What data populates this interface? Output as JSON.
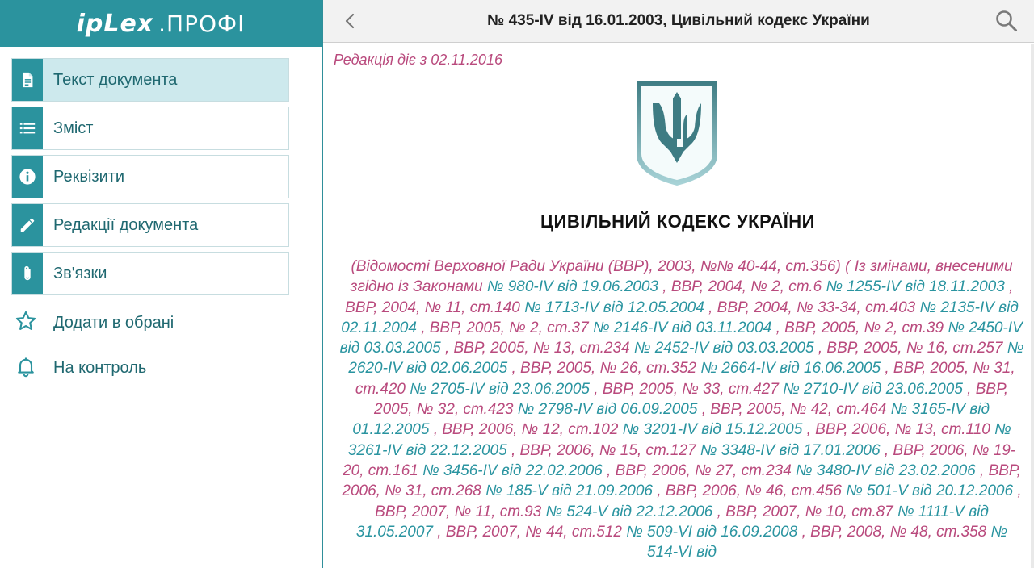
{
  "app": {
    "logo_brand": "ipLex",
    "logo_suffix": ".ПРОФІ"
  },
  "sidebar": {
    "items": [
      {
        "label": "Текст документа",
        "icon": "document-icon",
        "active": true
      },
      {
        "label": "Зміст",
        "icon": "list-icon",
        "active": false
      },
      {
        "label": "Реквізити",
        "icon": "info-icon",
        "active": false
      },
      {
        "label": "Редакції документа",
        "icon": "pencil-icon",
        "active": false
      },
      {
        "label": "Зв'язки",
        "icon": "paperclip-icon",
        "active": false
      }
    ],
    "extras": [
      {
        "label": "Додати в обрані",
        "icon": "star-icon"
      },
      {
        "label": "На контроль",
        "icon": "bell-icon"
      }
    ]
  },
  "header": {
    "title": "№ 435-IV від 16.01.2003, Цивільний кодекс України"
  },
  "document": {
    "edition": "Редакція діє з 02.11.2016",
    "title": "ЦИВІЛЬНИЙ КОДЕКС УКРАЇНИ",
    "amendments": [
      {
        "t": "s",
        "v": "(Відомості Верховної Ради України (ВВР), 2003, №№ 40-44, ст.356) ( Із змінами, внесеними згідно із Законами"
      },
      {
        "t": "l",
        "v": "№ 980-IV від 19.06.2003"
      },
      {
        "t": "s",
        "v": ", ВВР, 2004, № 2, ст.6"
      },
      {
        "t": "l",
        "v": "№ 1255-IV від 18.11.2003"
      },
      {
        "t": "s",
        "v": ", ВВР, 2004, № 11, ст.140"
      },
      {
        "t": "l",
        "v": "№ 1713-IV від 12.05.2004"
      },
      {
        "t": "s",
        "v": ", ВВР, 2004, № 33-34, ст.403"
      },
      {
        "t": "l",
        "v": "№ 2135-IV від 02.11.2004"
      },
      {
        "t": "s",
        "v": ", ВВР, 2005, № 2, ст.37"
      },
      {
        "t": "l",
        "v": "№ 2146-IV від 03.11.2004"
      },
      {
        "t": "s",
        "v": ", ВВР, 2005, № 2, ст.39"
      },
      {
        "t": "l",
        "v": "№ 2450-IV від 03.03.2005"
      },
      {
        "t": "s",
        "v": ", ВВР, 2005, № 13, ст.234"
      },
      {
        "t": "l",
        "v": "№ 2452-IV від 03.03.2005"
      },
      {
        "t": "s",
        "v": ", ВВР, 2005, № 16, ст.257"
      },
      {
        "t": "l",
        "v": "№ 2620-IV від 02.06.2005"
      },
      {
        "t": "s",
        "v": ", ВВР, 2005, № 26, ст.352"
      },
      {
        "t": "l",
        "v": "№ 2664-IV від 16.06.2005"
      },
      {
        "t": "s",
        "v": ", ВВР, 2005, № 31, ст.420"
      },
      {
        "t": "l",
        "v": "№ 2705-IV від 23.06.2005"
      },
      {
        "t": "s",
        "v": ", ВВР, 2005, № 33, ст.427"
      },
      {
        "t": "l",
        "v": "№ 2710-IV від 23.06.2005"
      },
      {
        "t": "s",
        "v": ", ВВР, 2005, № 32, ст.423"
      },
      {
        "t": "l",
        "v": "№ 2798-IV від 06.09.2005"
      },
      {
        "t": "s",
        "v": ", ВВР, 2005, № 42, ст.464"
      },
      {
        "t": "l",
        "v": "№ 3165-IV від 01.12.2005"
      },
      {
        "t": "s",
        "v": ", ВВР, 2006, № 12, ст.102"
      },
      {
        "t": "l",
        "v": "№ 3201-IV від 15.12.2005"
      },
      {
        "t": "s",
        "v": ", ВВР, 2006, № 13, ст.110"
      },
      {
        "t": "l",
        "v": "№ 3261-IV від 22.12.2005"
      },
      {
        "t": "s",
        "v": ", ВВР, 2006, № 15, ст.127"
      },
      {
        "t": "l",
        "v": "№ 3348-IV від 17.01.2006"
      },
      {
        "t": "s",
        "v": ", ВВР, 2006, № 19-20, ст.161"
      },
      {
        "t": "l",
        "v": "№ 3456-IV від 22.02.2006"
      },
      {
        "t": "s",
        "v": ", ВВР, 2006, № 27, ст.234"
      },
      {
        "t": "l",
        "v": "№ 3480-IV від 23.02.2006"
      },
      {
        "t": "s",
        "v": ", ВВР, 2006, № 31, ст.268"
      },
      {
        "t": "l",
        "v": "№ 185-V від 21.09.2006"
      },
      {
        "t": "s",
        "v": ", ВВР, 2006, № 46, ст.456"
      },
      {
        "t": "l",
        "v": "№ 501-V від 20.12.2006"
      },
      {
        "t": "s",
        "v": ", ВВР, 2007, № 11, ст.93"
      },
      {
        "t": "l",
        "v": "№ 524-V від 22.12.2006"
      },
      {
        "t": "s",
        "v": ", ВВР, 2007, № 10, ст.87"
      },
      {
        "t": "l",
        "v": "№ 1111-V від 31.05.2007"
      },
      {
        "t": "s",
        "v": ", ВВР, 2007, № 44, ст.512"
      },
      {
        "t": "l",
        "v": "№ 509-VI від 16.09.2008"
      },
      {
        "t": "s",
        "v": ", ВВР, 2008, № 48, ст.358"
      },
      {
        "t": "l",
        "v": "№ 514-VI від"
      }
    ]
  },
  "colors": {
    "brand_teal": "#2b939e",
    "active_item_bg": "#cde9ed",
    "source_text": "#b94a7d",
    "law_link": "#2a94a0"
  }
}
